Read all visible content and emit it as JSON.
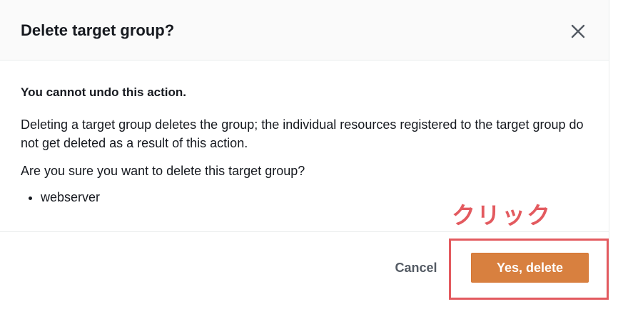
{
  "dialog": {
    "title": "Delete target group?",
    "close_icon": "close-icon",
    "warning": "You cannot undo this action.",
    "description": "Deleting a target group deletes the group; the individual resources registered to the target group do not get deleted as a result of this action.",
    "confirm_question": "Are you sure you want to delete this target group?",
    "resources": [
      "webserver"
    ],
    "cancel_label": "Cancel",
    "delete_label": "Yes, delete"
  },
  "annotation": {
    "label": "クリック",
    "color": "#e35a5f"
  },
  "colors": {
    "primary_button": "#d8803f",
    "title_text": "#16191f",
    "cancel_text": "#545b64",
    "header_bg": "#fafafa"
  }
}
